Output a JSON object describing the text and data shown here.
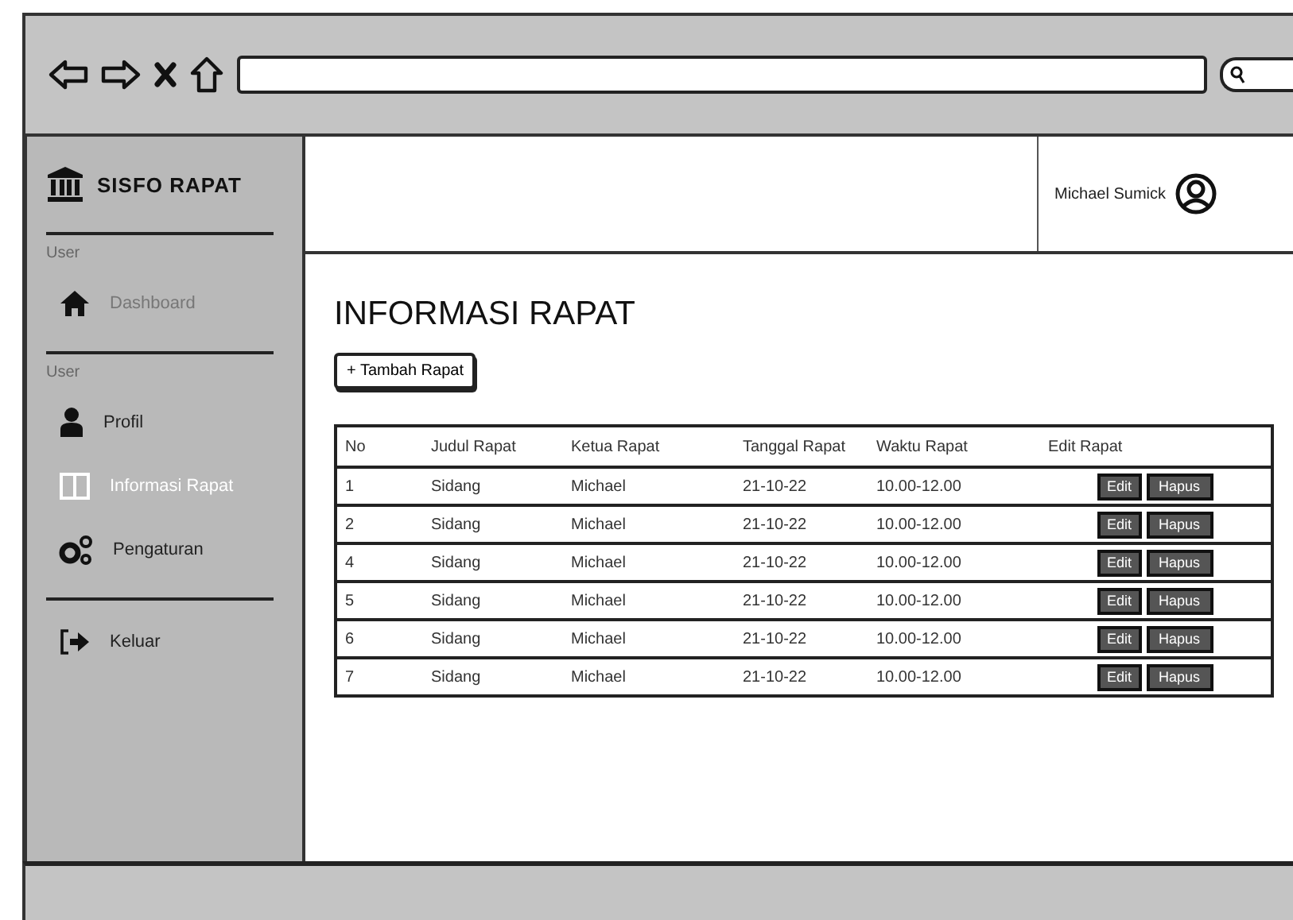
{
  "sidebar": {
    "logo": "SISFO RAPAT",
    "sections": [
      {
        "label": "User",
        "items": [
          {
            "label": "Dashboard",
            "selected": false,
            "disabled": true
          }
        ]
      },
      {
        "label": "User",
        "items": [
          {
            "label": "Profil",
            "selected": false,
            "disabled": false
          },
          {
            "label": "Informasi Rapat",
            "selected": true,
            "disabled": false
          },
          {
            "label": "Pengaturan",
            "selected": false,
            "disabled": false
          }
        ]
      },
      {
        "items": [
          {
            "label": "Keluar",
            "selected": false,
            "disabled": false
          }
        ]
      }
    ]
  },
  "header": {
    "user_name": "Michael Sumick"
  },
  "page_title": "INFORMASI RAPAT",
  "add_button": "+ Tambah Rapat",
  "table": {
    "columns": [
      "No",
      "Judul Rapat",
      "Ketua Rapat",
      "Tanggal Rapat",
      "Waktu Rapat",
      "Edit Rapat"
    ],
    "rows": [
      {
        "no": "1",
        "judul": "Sidang",
        "ketua": "Michael",
        "tanggal": "21-10-22",
        "waktu": "10.00-12.00",
        "actions": [
          "Edit",
          "Hapus"
        ]
      },
      {
        "no": "2",
        "judul": "Sidang",
        "ketua": "Michael",
        "tanggal": "21-10-22",
        "waktu": "10.00-12.00",
        "actions": [
          "Edit",
          "Hapus"
        ]
      },
      {
        "no": "4",
        "judul": "Sidang",
        "ketua": "Michael",
        "tanggal": "21-10-22",
        "waktu": "10.00-12.00",
        "actions": [
          "Edit",
          "Hapus"
        ]
      },
      {
        "no": "5",
        "judul": "Sidang",
        "ketua": "Michael",
        "tanggal": "21-10-22",
        "waktu": "10.00-12.00",
        "actions": [
          "Edit",
          "Hapus"
        ]
      },
      {
        "no": "6",
        "judul": "Sidang",
        "ketua": "Michael",
        "tanggal": "21-10-22",
        "waktu": "10.00-12.00",
        "actions": [
          "Edit",
          "Hapus"
        ]
      },
      {
        "no": "7",
        "judul": "Sidang",
        "ketua": "Michael",
        "tanggal": "21-10-22",
        "waktu": "10.00-12.00",
        "actions": [
          "Edit",
          "Hapus"
        ]
      }
    ]
  }
}
